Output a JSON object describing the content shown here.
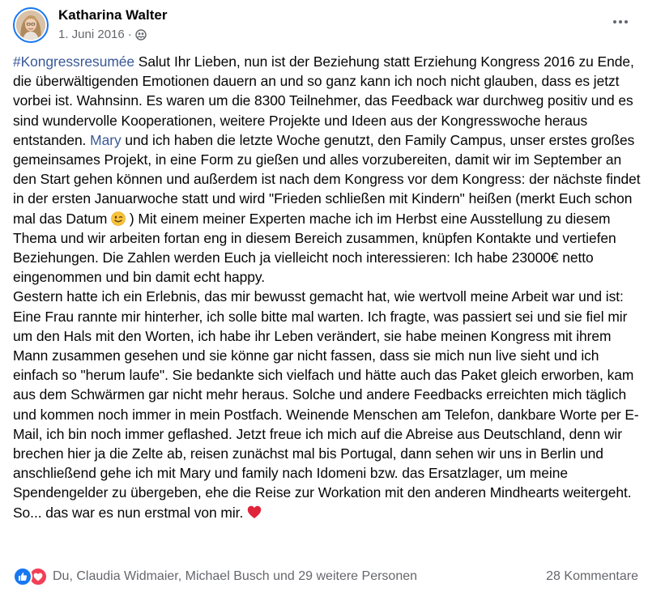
{
  "post": {
    "author": "Katharina Walter",
    "date": "1. Juni 2016",
    "separator": "·",
    "audience_icon": "friends-icon",
    "more_icon": "more-horizontal-icon",
    "text": {
      "hashtag": "#Kongressresumée",
      "part1": " Salut Ihr Lieben, nun ist der Beziehung statt Erziehung Kongress 2016 zu Ende, die überwältigenden Emotionen dauern an und so ganz kann ich noch nicht glauben, dass es jetzt vorbei ist. Wahnsinn. Es waren um die 8300 Teilnehmer, das Feedback war durchweg positiv und es sind wundervolle Kooperationen, weitere Projekte und Ideen aus der Kongresswoche heraus entstanden. ",
      "mention": "Mary",
      "part2": " und ich haben die letzte Woche genutzt, den Family Campus, unser erstes großes gemeinsames Projekt, in eine Form zu gießen und alles vorzubereiten, damit wir im September an den Start gehen können und außerdem ist nach dem Kongress vor dem Kongress: der nächste findet in der ersten Januarwoche statt und wird \"Frieden schließen mit Kindern\" heißen (merkt Euch schon mal das Datum ",
      "emoji_wink": "winking-face-emoji",
      "part3": " ) Mit einem meiner Experten mache ich im Herbst eine Ausstellung zu diesem Thema und wir arbeiten fortan eng in diesem Bereich zusammen, knüpfen Kontakte und vertiefen Beziehungen. Die Zahlen werden Euch ja vielleicht noch interessieren: Ich habe 23000€ netto eingenommen und bin damit echt happy.",
      "paragraph2": "Gestern hatte ich ein Erlebnis, das mir bewusst gemacht hat, wie wertvoll meine Arbeit war und ist: Eine Frau rannte mir hinterher, ich solle bitte mal warten. Ich fragte, was passiert sei und sie fiel mir um den Hals mit den Worten, ich habe ihr Leben verändert, sie habe meinen Kongress mit ihrem Mann zusammen gesehen und sie könne gar nicht fassen, dass sie mich nun live sieht und ich einfach so \"herum laufe\". Sie bedankte sich vielfach und hätte auch das Paket gleich erworben, kam aus dem Schwärmen gar nicht mehr heraus. Solche und andere Feedbacks erreichten mich täglich und kommen noch immer in mein Postfach. Weinende Menschen am Telefon, dankbare Worte per E-Mail, ich bin noch immer geflashed. Jetzt freue ich mich auf die Abreise aus Deutschland, denn wir brechen hier ja die Zelte ab, reisen zunächst mal bis Portugal, dann sehen wir uns in Berlin und anschließend gehe ich mit Mary und family nach Idomeni bzw. das Ersatzlager, um meine Spendengelder zu übergeben, ehe die Reise zur Workation mit den anderen Mindhearts weitergeht. So... das war es nun erstmal von mir. ",
      "emoji_heart": "red-heart-emoji"
    },
    "reactions": {
      "icons": [
        "like-icon",
        "love-icon"
      ],
      "summary": "Du, Claudia Widmaier, Michael Busch und 29 weitere Personen"
    },
    "comments_label": "28 Kommentare",
    "colors": {
      "link": "#385898",
      "like": "#1877f2",
      "love": "#f33e58",
      "secondary_text": "#65676b"
    }
  }
}
